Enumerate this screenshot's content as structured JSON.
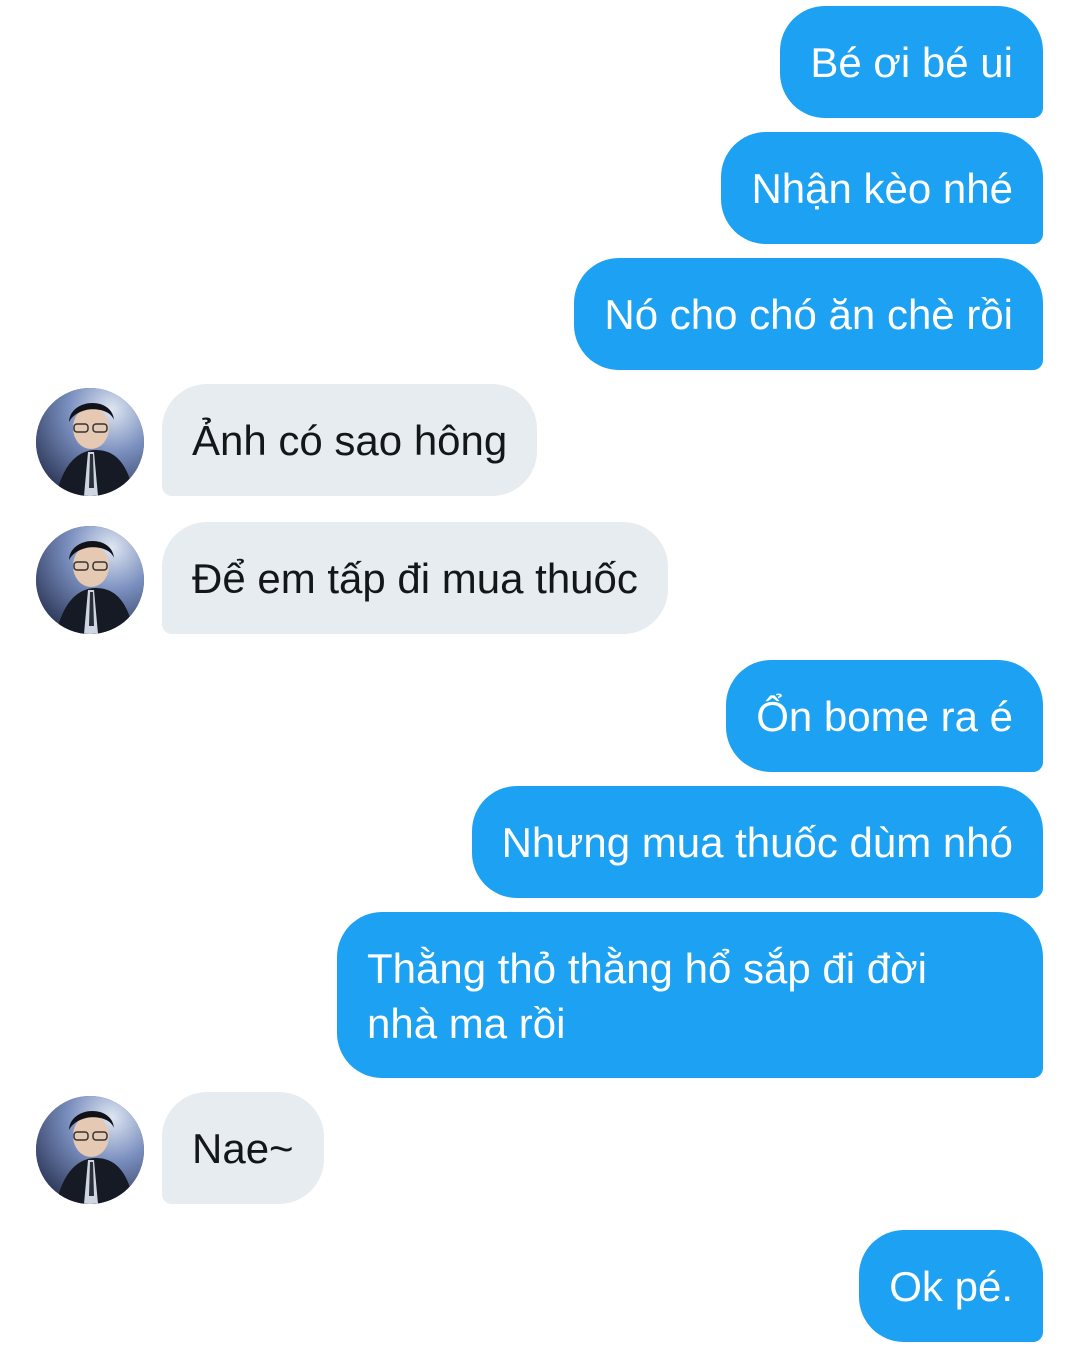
{
  "conversation": {
    "messages": [
      {
        "side": "sent",
        "text": "Bé ơi bé ui"
      },
      {
        "side": "sent",
        "text": "Nhận kèo nhé"
      },
      {
        "side": "sent",
        "text": "Nó cho chó ăn chè rồi"
      },
      {
        "side": "received",
        "text": "Ảnh có sao hông"
      },
      {
        "side": "received",
        "text": "Để em tấp đi mua thuốc"
      },
      {
        "side": "sent",
        "text": "Ổn bome ra é"
      },
      {
        "side": "sent",
        "text": "Nhưng mua thuốc dùm nhó"
      },
      {
        "side": "sent",
        "text": "Thằng thỏ thằng hổ sắp đi đời\nnhà ma rồi"
      },
      {
        "side": "received",
        "text": "Nae~"
      },
      {
        "side": "sent",
        "text": "Ok pé."
      }
    ]
  },
  "colors": {
    "sent_bubble": "#1da1f2",
    "received_bubble": "#e6ecf0"
  },
  "icons": {
    "avatar": "profile-photo"
  }
}
